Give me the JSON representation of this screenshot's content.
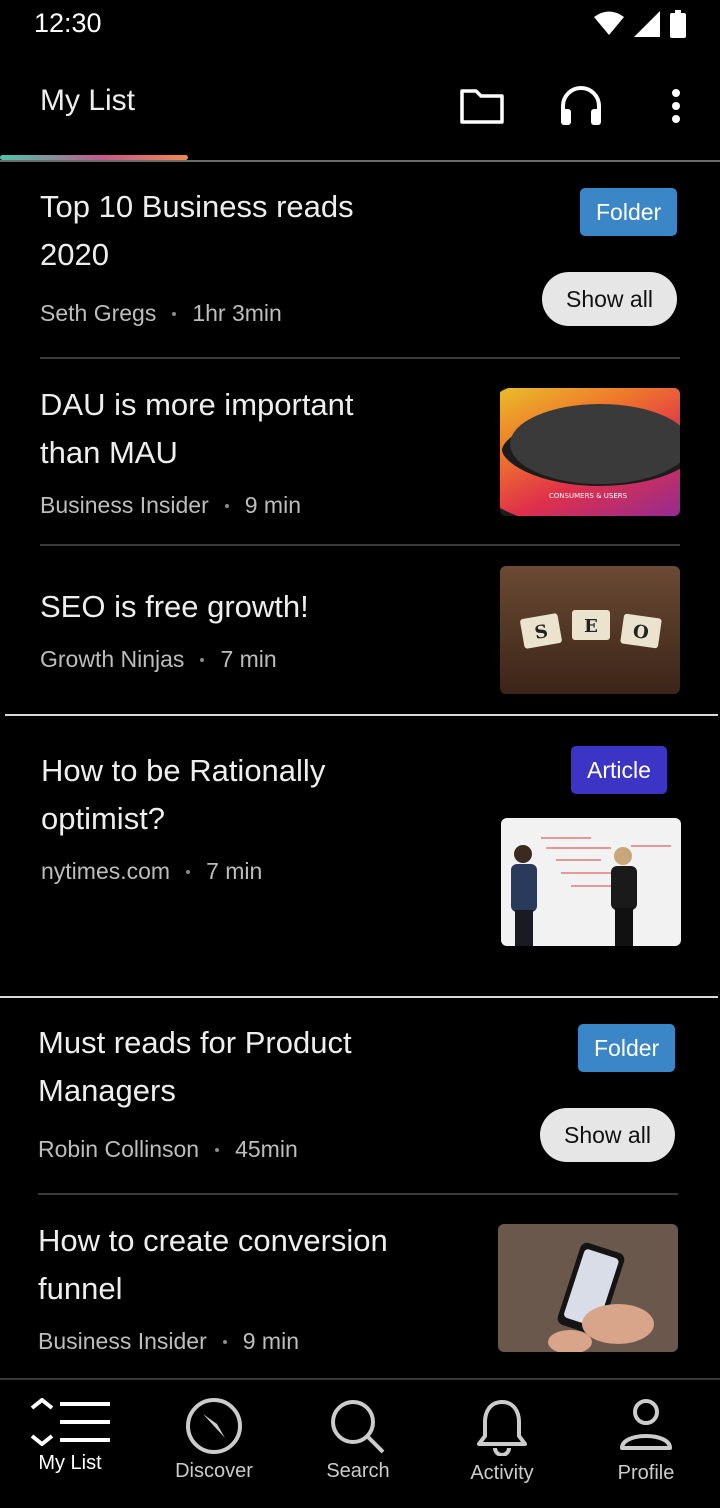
{
  "status": {
    "time": "12:30"
  },
  "appbar": {
    "title": "My List",
    "icons": [
      "folder-icon",
      "headphones-icon",
      "more-vert-icon"
    ]
  },
  "progress": {
    "fraction": 0.26
  },
  "items": [
    {
      "title_l1": "Top 10 Business reads",
      "title_l2": "2020",
      "author": "Seth Gregs",
      "duration": "1hr 3min",
      "badge": "Folder",
      "action": "Show all"
    },
    {
      "title_l1": "DAU is more important",
      "title_l2": "than MAU",
      "author": "Business Insider",
      "duration": "9 min",
      "image_label": "CONSUMERS & USERS"
    },
    {
      "title_l1": "SEO is free growth!",
      "author": "Growth Ninjas",
      "duration": "7 min",
      "image_letters": [
        "S",
        "E",
        "O"
      ]
    },
    {
      "title_l1": "How to be Rationally",
      "title_l2": "optimist?",
      "author": "nytimes.com",
      "duration": "7 min",
      "badge": "Article"
    },
    {
      "title_l1": "Must reads for Product",
      "title_l2": "Managers",
      "author": "Robin Collinson",
      "duration": "45min",
      "badge": "Folder",
      "action": "Show all"
    },
    {
      "title_l1": "How to create conversion",
      "title_l2": "funnel",
      "author": "Business Insider",
      "duration": "9 min"
    }
  ],
  "nav": [
    {
      "label": "My List",
      "icon": "list-icon",
      "active": true
    },
    {
      "label": "Discover",
      "icon": "compass-icon"
    },
    {
      "label": "Search",
      "icon": "search-icon"
    },
    {
      "label": "Activity",
      "icon": "bell-icon"
    },
    {
      "label": "Profile",
      "icon": "person-icon"
    }
  ],
  "colors": {
    "folder_badge": "#3a86c6",
    "article_badge": "#3c34c4",
    "background": "#000000"
  }
}
